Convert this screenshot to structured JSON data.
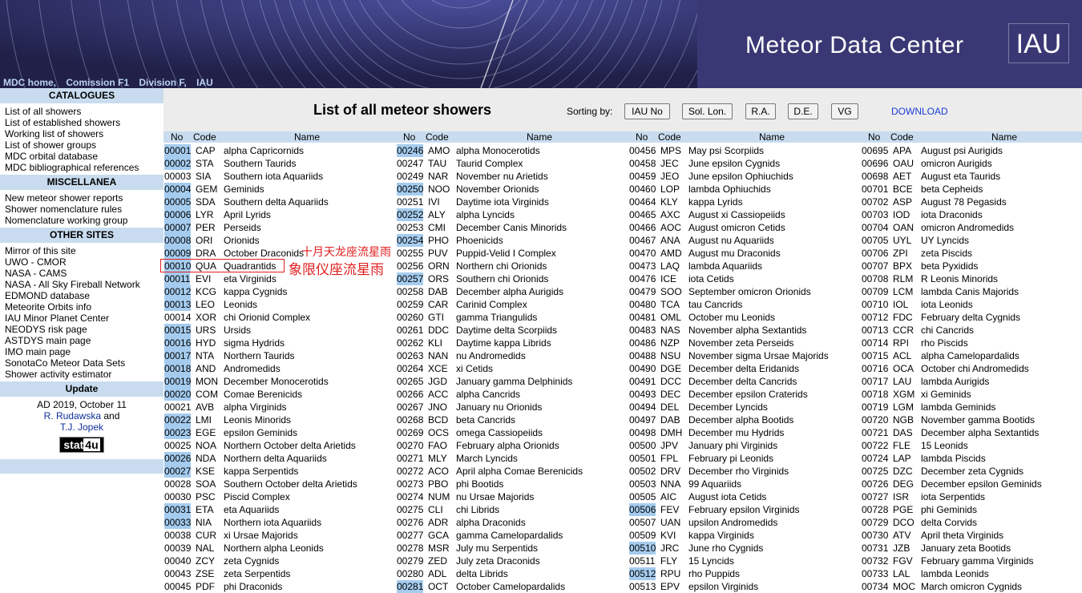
{
  "header": {
    "nav": [
      "MDC home,",
      "Comission F1",
      "Division F,",
      "IAU"
    ],
    "title": "Meteor Data Center",
    "logo": "IAU"
  },
  "sidebar": {
    "sections": [
      {
        "title": "CATALOGUES",
        "items": [
          "List of all showers",
          "List of established showers",
          "Working list of showers",
          "List of shower groups",
          "MDC orbital database",
          "MDC bibliographical references"
        ]
      },
      {
        "title": "MISCELLANEA",
        "items": [
          "New meteor shower reports",
          "Shower nomenclature rules",
          "Nomenclature working group"
        ]
      },
      {
        "title": "OTHER SITES",
        "items": [
          "Mirror of this site",
          "UWO - CMOR",
          "NASA - CAMS",
          "NASA - All Sky Fireball Network",
          "EDMOND database",
          "Meteorite Orbits info",
          "IAU Minor Planet Center",
          "NEODYS risk page",
          "ASTDYS main page",
          "IMO main page",
          "SonotaCo Meteor Data Sets",
          "Shower activity estimator"
        ]
      }
    ],
    "update": {
      "title": "Update",
      "date": "AD 2019, October 11",
      "author1": "R. Rudawska",
      "and": "and",
      "author2": "T.J. Jopek",
      "badge_a": "stat",
      "badge_b": "4u"
    }
  },
  "toolbar": {
    "title": "List of all meteor showers",
    "sort_label": "Sorting by:",
    "buttons": [
      "IAU No",
      "Sol. Lon.",
      "R.A.",
      "D.E.",
      "VG"
    ],
    "download": "DOWNLOAD"
  },
  "table": {
    "headers": {
      "no": "No",
      "code": "Code",
      "name": "Name"
    },
    "columns": [
      [
        [
          "00001",
          "CAP",
          "alpha Capricornids",
          1
        ],
        [
          "00002",
          "STA",
          "Southern Taurids",
          1
        ],
        [
          "00003",
          "SIA",
          "Southern iota Aquariids",
          0
        ],
        [
          "00004",
          "GEM",
          "Geminids",
          1
        ],
        [
          "00005",
          "SDA",
          "Southern delta Aquariids",
          1
        ],
        [
          "00006",
          "LYR",
          "April Lyrids",
          1
        ],
        [
          "00007",
          "PER",
          "Perseids",
          1
        ],
        [
          "00008",
          "ORI",
          "Orionids",
          1
        ],
        [
          "00009",
          "DRA",
          "October Draconids",
          1
        ],
        [
          "00010",
          "QUA",
          "Quadrantids",
          1
        ],
        [
          "00011",
          "EVI",
          "eta Virginids",
          1
        ],
        [
          "00012",
          "KCG",
          "kappa Cygnids",
          1
        ],
        [
          "00013",
          "LEO",
          "Leonids",
          1
        ],
        [
          "00014",
          "XOR",
          "chi Orionid Complex",
          0
        ],
        [
          "00015",
          "URS",
          "Ursids",
          1
        ],
        [
          "00016",
          "HYD",
          "sigma Hydrids",
          1
        ],
        [
          "00017",
          "NTA",
          "Northern Taurids",
          1
        ],
        [
          "00018",
          "AND",
          "Andromedids",
          1
        ],
        [
          "00019",
          "MON",
          "December Monocerotids",
          1
        ],
        [
          "00020",
          "COM",
          "Comae Berenicids",
          1
        ],
        [
          "00021",
          "AVB",
          "alpha Virginids",
          0
        ],
        [
          "00022",
          "LMI",
          "Leonis Minorids",
          1
        ],
        [
          "00023",
          "EGE",
          "epsilon Geminids",
          1
        ],
        [
          "00025",
          "NOA",
          "Northern October delta Arietids",
          0
        ],
        [
          "00026",
          "NDA",
          "Northern delta Aquariids",
          1
        ],
        [
          "00027",
          "KSE",
          "kappa Serpentids",
          1
        ],
        [
          "00028",
          "SOA",
          "Southern October delta Arietids",
          0
        ],
        [
          "00030",
          "PSC",
          "Piscid Complex",
          0
        ],
        [
          "00031",
          "ETA",
          "eta Aquariids",
          1
        ],
        [
          "00033",
          "NIA",
          "Northern iota Aquariids",
          1
        ],
        [
          "00038",
          "CUR",
          "xi Ursae Majorids",
          0
        ],
        [
          "00039",
          "NAL",
          "Northern alpha Leonids",
          0
        ],
        [
          "00040",
          "ZCY",
          "zeta Cygnids",
          0
        ],
        [
          "00043",
          "ZSE",
          "zeta Serpentids",
          0
        ],
        [
          "00045",
          "PDF",
          "phi Draconids",
          0
        ]
      ],
      [
        [
          "00246",
          "AMO",
          "alpha Monocerotids",
          1
        ],
        [
          "00247",
          "TAU",
          "Taurid Complex",
          0
        ],
        [
          "00249",
          "NAR",
          "November nu Arietids",
          0
        ],
        [
          "00250",
          "NOO",
          "November Orionids",
          1
        ],
        [
          "00251",
          "IVI",
          "Daytime iota Virginids",
          0
        ],
        [
          "00252",
          "ALY",
          "alpha Lyncids",
          1
        ],
        [
          "00253",
          "CMI",
          "December Canis Minorids",
          0
        ],
        [
          "00254",
          "PHO",
          "Phoenicids",
          1
        ],
        [
          "00255",
          "PUV",
          "Puppid-Velid I Complex",
          0
        ],
        [
          "00256",
          "ORN",
          "Northern chi Orionids",
          0
        ],
        [
          "00257",
          "ORS",
          "Southern chi Orionids",
          1
        ],
        [
          "00258",
          "DAB",
          "December alpha Aurigids",
          0
        ],
        [
          "00259",
          "CAR",
          "Carinid Complex",
          0
        ],
        [
          "00260",
          "GTI",
          "gamma Triangulids",
          0
        ],
        [
          "00261",
          "DDC",
          "Daytime delta Scorpiids",
          0
        ],
        [
          "00262",
          "KLI",
          "Daytime kappa Librids",
          0
        ],
        [
          "00263",
          "NAN",
          "nu Andromedids",
          0
        ],
        [
          "00264",
          "XCE",
          "xi Cetids",
          0
        ],
        [
          "00265",
          "JGD",
          "January gamma Delphinids",
          0
        ],
        [
          "00266",
          "ACC",
          "alpha Cancrids",
          0
        ],
        [
          "00267",
          "JNO",
          "January nu Orionids",
          0
        ],
        [
          "00268",
          "BCD",
          "beta Cancrids",
          0
        ],
        [
          "00269",
          "OCS",
          "omega Cassiopeiids",
          0
        ],
        [
          "00270",
          "FAO",
          "February alpha Orionids",
          0
        ],
        [
          "00271",
          "MLY",
          "March Lyncids",
          0
        ],
        [
          "00272",
          "ACO",
          "April alpha Comae Berenicids",
          0
        ],
        [
          "00273",
          "PBO",
          "phi Bootids",
          0
        ],
        [
          "00274",
          "NUM",
          "nu Ursae Majorids",
          0
        ],
        [
          "00275",
          "CLI",
          "chi Librids",
          0
        ],
        [
          "00276",
          "ADR",
          "alpha Draconids",
          0
        ],
        [
          "00277",
          "GCA",
          "gamma Camelopardalids",
          0
        ],
        [
          "00278",
          "MSR",
          "July mu Serpentids",
          0
        ],
        [
          "00279",
          "ZED",
          "July zeta Draconids",
          0
        ],
        [
          "00280",
          "ADL",
          "delta Librids",
          0
        ],
        [
          "00281",
          "OCT",
          "October Camelopardalids",
          1
        ]
      ],
      [
        [
          "00456",
          "MPS",
          "May psi Scorpiids",
          0
        ],
        [
          "00458",
          "JEC",
          "June epsilon Cygnids",
          0
        ],
        [
          "00459",
          "JEO",
          "June epsilon Ophiuchids",
          0
        ],
        [
          "00460",
          "LOP",
          "lambda Ophiuchids",
          0
        ],
        [
          "00464",
          "KLY",
          "kappa Lyrids",
          0
        ],
        [
          "00465",
          "AXC",
          "August xi Cassiopeiids",
          0
        ],
        [
          "00466",
          "AOC",
          "August omicron Cetids",
          0
        ],
        [
          "00467",
          "ANA",
          "August nu Aquariids",
          0
        ],
        [
          "00470",
          "AMD",
          "August mu Draconids",
          0
        ],
        [
          "00473",
          "LAQ",
          "lambda Aquariids",
          0
        ],
        [
          "00476",
          "ICE",
          "iota Cetids",
          0
        ],
        [
          "00479",
          "SOO",
          "September omicron Orionids",
          0
        ],
        [
          "00480",
          "TCA",
          "tau Cancrids",
          0
        ],
        [
          "00481",
          "OML",
          "October mu Leonids",
          0
        ],
        [
          "00483",
          "NAS",
          "November alpha Sextantids",
          0
        ],
        [
          "00486",
          "NZP",
          "November zeta Perseids",
          0
        ],
        [
          "00488",
          "NSU",
          "November sigma Ursae Majorids",
          0
        ],
        [
          "00490",
          "DGE",
          "December delta Eridanids",
          0
        ],
        [
          "00491",
          "DCC",
          "December delta Cancrids",
          0
        ],
        [
          "00493",
          "DEC",
          "December epsilon Craterids",
          0
        ],
        [
          "00494",
          "DEL",
          "December Lyncids",
          0
        ],
        [
          "00497",
          "DAB",
          "December alpha Bootids",
          0
        ],
        [
          "00498",
          "DMH",
          "December mu Hydrids",
          0
        ],
        [
          "00500",
          "JPV",
          "January phi Virginids",
          0
        ],
        [
          "00501",
          "FPL",
          "February pi Leonids",
          0
        ],
        [
          "00502",
          "DRV",
          "December rho Virginids",
          0
        ],
        [
          "00503",
          "NNA",
          "99 Aquariids",
          0
        ],
        [
          "00505",
          "AIC",
          "August iota Cetids",
          0
        ],
        [
          "00506",
          "FEV",
          "February epsilon Virginids",
          1
        ],
        [
          "00507",
          "UAN",
          "upsilon Andromedids",
          0
        ],
        [
          "00509",
          "KVI",
          "kappa Virginids",
          0
        ],
        [
          "00510",
          "JRC",
          "June rho Cygnids",
          1
        ],
        [
          "00511",
          "FLY",
          "15 Lyncids",
          0
        ],
        [
          "00512",
          "RPU",
          "rho Puppids",
          1
        ],
        [
          "00513",
          "EPV",
          "epsilon Virginids",
          0
        ]
      ],
      [
        [
          "00695",
          "APA",
          "August psi Aurigids",
          0
        ],
        [
          "00696",
          "OAU",
          "omicron Aurigids",
          0
        ],
        [
          "00698",
          "AET",
          "August eta Taurids",
          0
        ],
        [
          "00701",
          "BCE",
          "beta Cepheids",
          0
        ],
        [
          "00702",
          "ASP",
          "August 78 Pegasids",
          0
        ],
        [
          "00703",
          "IOD",
          "iota Draconids",
          0
        ],
        [
          "00704",
          "OAN",
          "omicron Andromedids",
          0
        ],
        [
          "00705",
          "UYL",
          "UY Lyncids",
          0
        ],
        [
          "00706",
          "ZPI",
          "zeta Piscids",
          0
        ],
        [
          "00707",
          "BPX",
          "beta Pyxidids",
          0
        ],
        [
          "00708",
          "RLM",
          "R Leonis Minorids",
          0
        ],
        [
          "00709",
          "LCM",
          "lambda Canis Majorids",
          0
        ],
        [
          "00710",
          "IOL",
          "iota Leonids",
          0
        ],
        [
          "00712",
          "FDC",
          "February delta Cygnids",
          0
        ],
        [
          "00713",
          "CCR",
          "chi Cancrids",
          0
        ],
        [
          "00714",
          "RPI",
          "rho Piscids",
          0
        ],
        [
          "00715",
          "ACL",
          "alpha Camelopardalids",
          0
        ],
        [
          "00716",
          "OCA",
          "October chi Andromedids",
          0
        ],
        [
          "00717",
          "LAU",
          "lambda Aurigids",
          0
        ],
        [
          "00718",
          "XGM",
          "xi Geminids",
          0
        ],
        [
          "00719",
          "LGM",
          "lambda Geminids",
          0
        ],
        [
          "00720",
          "NGB",
          "November gamma Bootids",
          0
        ],
        [
          "00721",
          "DAS",
          "December alpha Sextantids",
          0
        ],
        [
          "00722",
          "FLE",
          "15 Leonids",
          0
        ],
        [
          "00724",
          "LAP",
          "lambda Piscids",
          0
        ],
        [
          "00725",
          "DZC",
          "December zeta Cygnids",
          0
        ],
        [
          "00726",
          "DEG",
          "December epsilon Geminids",
          0
        ],
        [
          "00727",
          "ISR",
          "iota Serpentids",
          0
        ],
        [
          "00728",
          "PGE",
          "phi Geminids",
          0
        ],
        [
          "00729",
          "DCO",
          "delta Corvids",
          0
        ],
        [
          "00730",
          "ATV",
          "April theta Virginids",
          0
        ],
        [
          "00731",
          "JZB",
          "January zeta Bootids",
          0
        ],
        [
          "00732",
          "FGV",
          "February gamma Virginids",
          0
        ],
        [
          "00733",
          "LAL",
          "lambda Leonids",
          0
        ],
        [
          "00734",
          "MOC",
          "March omicron Cygnids",
          0
        ]
      ]
    ]
  },
  "annotation": {
    "label1": "十月天龙座流星雨",
    "label2": "象限仪座流星雨"
  }
}
